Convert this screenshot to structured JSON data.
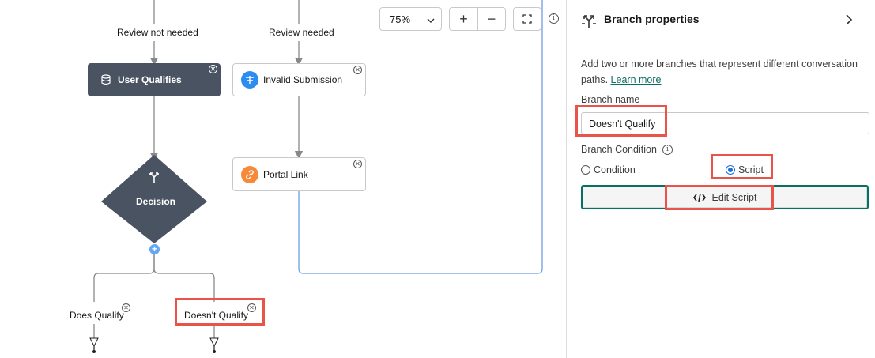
{
  "canvas": {
    "edge_labels": {
      "review_not_needed": "Review not needed",
      "review_needed": "Review needed"
    },
    "nodes": {
      "user_qualifies": "User Qualifies",
      "invalid_submission": "Invalid Submission",
      "portal_link": "Portal Link",
      "decision": "Decision"
    },
    "branches": {
      "does_qualify": "Does Qualify",
      "doesnt_qualify": "Doesn't Qualify"
    },
    "toolbar": {
      "zoom": "75%",
      "zoom_in": "+",
      "zoom_out": "−"
    },
    "colors": {
      "highlight": "#e8544a",
      "dark_node": "#4a5361",
      "invalid_icon": "#2d8cf0",
      "portal_icon": "#f58a3b",
      "add_button": "#62a8f6"
    }
  },
  "panel": {
    "title": "Branch properties",
    "description": "Add two or more branches that represent different conversation paths.",
    "learn_more": "Learn more",
    "branch_name_label": "Branch name",
    "branch_name_value": "Doesn't Qualify",
    "branch_condition_label": "Branch Condition",
    "radio_condition": "Condition",
    "radio_script": "Script",
    "selected": "Script",
    "edit_script": "Edit Script",
    "colors": {
      "accent": "#0b6e63",
      "radio_selected": "#1a6fd8"
    }
  }
}
